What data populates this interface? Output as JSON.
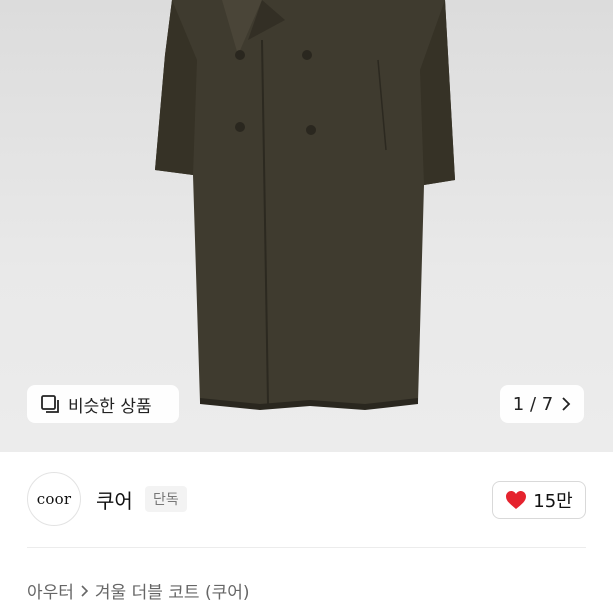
{
  "hero": {
    "image_icon": "coat-product-image",
    "similar_icon": "similar-items-icon",
    "similar_label": "비슷한 상품",
    "pager_current": "1",
    "pager_separator": "/",
    "pager_total": "7",
    "pager_icon": "chevron-right-icon"
  },
  "brand": {
    "logo_text": "coor",
    "name": "쿠어",
    "badge": "단독",
    "like_icon": "heart-icon",
    "like_count": "15만",
    "like_color": "#e5232e"
  },
  "breadcrumb": {
    "category": "아우터",
    "separator_icon": "chevron-right-icon",
    "product": "겨울 더블 코트 (쿠어)"
  }
}
